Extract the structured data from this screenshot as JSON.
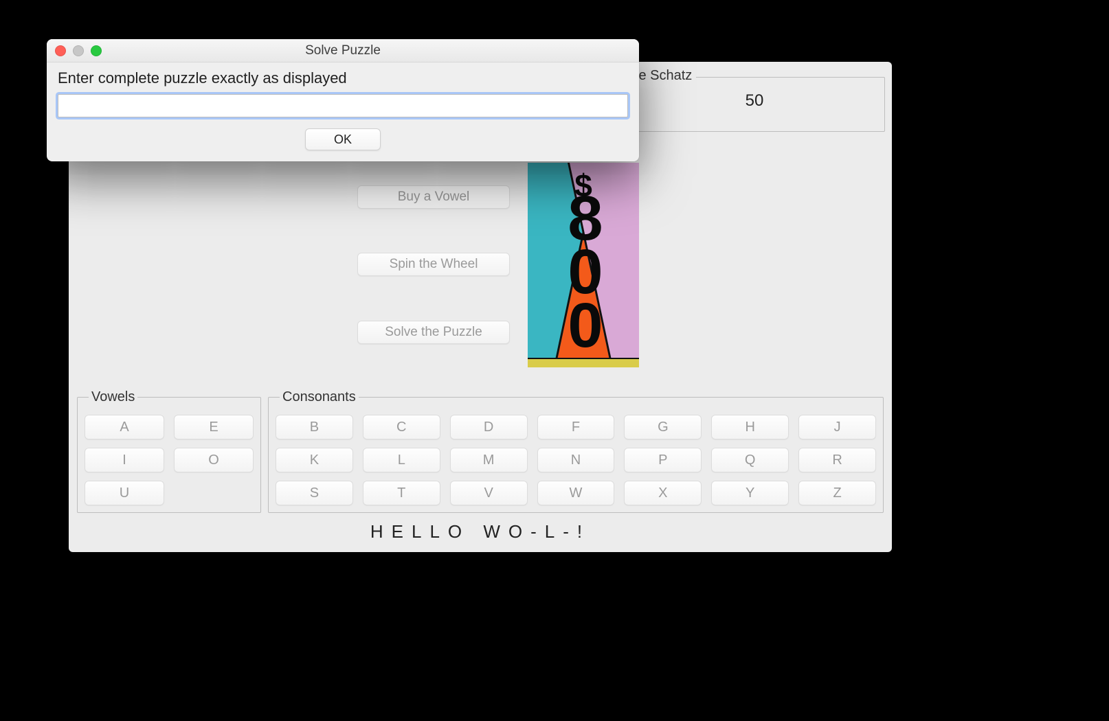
{
  "modal": {
    "title": "Solve Puzzle",
    "prompt": "Enter complete puzzle exactly as displayed",
    "input_value": "",
    "ok_label": "OK"
  },
  "player": {
    "name": "le Schatz",
    "score": "50"
  },
  "actions": {
    "buy_vowel": "Buy a Vowel",
    "spin_wheel": "Spin the Wheel",
    "solve_puzzle": "Solve the Puzzle"
  },
  "wheel": {
    "currency": "$",
    "amount": "800"
  },
  "letter_groups": {
    "vowels_label": "Vowels",
    "consonants_label": "Consonants",
    "vowels": [
      "A",
      "E",
      "I",
      "O",
      "U"
    ],
    "consonants": [
      "B",
      "C",
      "D",
      "F",
      "G",
      "H",
      "J",
      "K",
      "L",
      "M",
      "N",
      "P",
      "Q",
      "R",
      "S",
      "T",
      "V",
      "W",
      "X",
      "Y",
      "Z"
    ]
  },
  "puzzle_display": "HELLO WO-L-!"
}
